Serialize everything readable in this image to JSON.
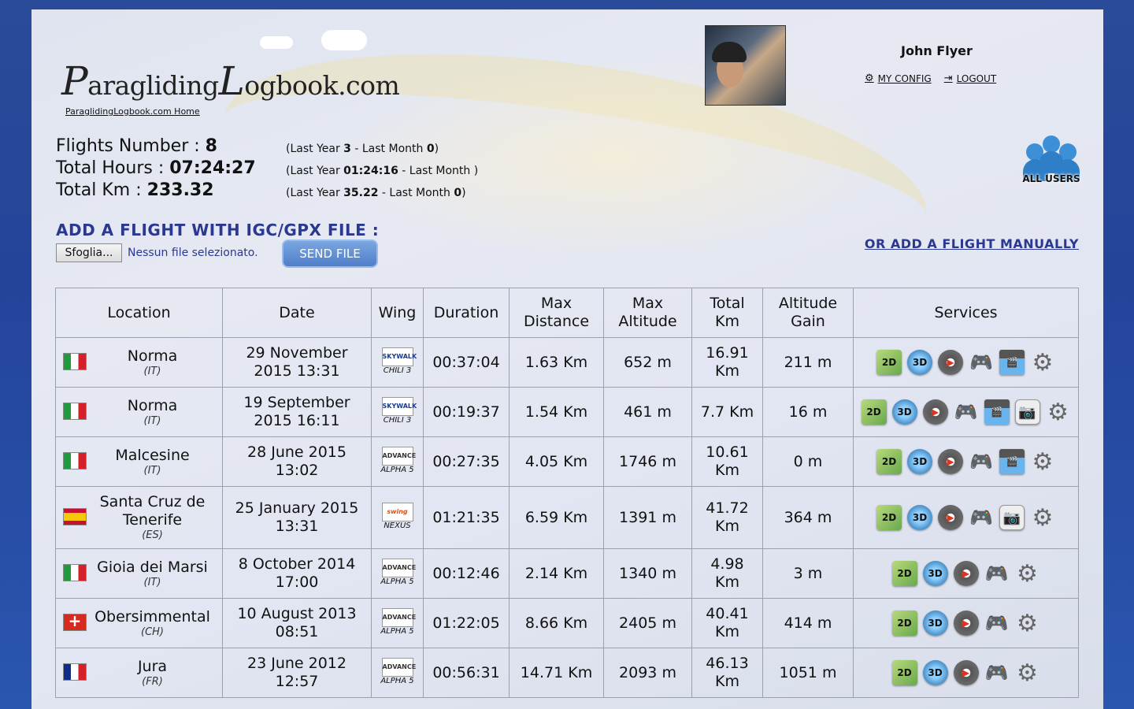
{
  "logo": {
    "text_p": "P",
    "text_rest1": "aragliding",
    "text_l": "L",
    "text_rest2": "ogbook.com",
    "home_link": "ParaglidingLogbook.com Home"
  },
  "user": {
    "name": "John Flyer",
    "config_label": "MY CONFIG",
    "logout_label": "LOGOUT"
  },
  "stats": {
    "flights_label": "Flights Number :",
    "flights_value": "8",
    "hours_label": "Total Hours :",
    "hours_value": "07:24:27",
    "km_label": "Total Km :",
    "km_value": "233.32",
    "flights_sub_a": "(Last Year ",
    "flights_sub_ly": "3",
    "flights_sub_b": " - Last Month ",
    "flights_sub_lm": "0",
    "flights_sub_c": ")",
    "hours_sub_a": "(Last Year ",
    "hours_sub_ly": "01:24:16",
    "hours_sub_b": " - Last Month )",
    "km_sub_a": "(Last Year ",
    "km_sub_ly": "35.22",
    "km_sub_b": " - Last Month ",
    "km_sub_lm": "0",
    "km_sub_c": ")"
  },
  "all_users_label": "ALL USERS",
  "upload": {
    "title": "ADD A FLIGHT WITH IGC/GPX FILE :",
    "browse_label": "Sfoglia...",
    "no_file": "Nessun file selezionato.",
    "send_label": "SEND FILE",
    "manual_link": "OR ADD A FLIGHT MANUALLY"
  },
  "table": {
    "headers": [
      "Location",
      "Date",
      "Wing",
      "Duration",
      "Max Distance",
      "Max Altitude",
      "Total Km",
      "Altitude Gain",
      "Services"
    ],
    "rows": [
      {
        "flag": "it",
        "location": "Norma",
        "cc": "(IT)",
        "date1": "29 November",
        "date2": "2015 13:31",
        "wing_brand": "SKYWALK",
        "wing_model": "CHILI 3",
        "duration": "00:37:04",
        "max_dist": "1.63 Km",
        "max_alt": "652 m",
        "total_km1": "16.91",
        "total_km2": "Km",
        "gain": "211 m"
      },
      {
        "flag": "it",
        "location": "Norma",
        "cc": "(IT)",
        "date1": "19 September",
        "date2": "2015 16:11",
        "wing_brand": "SKYWALK",
        "wing_model": "CHILI 3",
        "duration": "00:19:37",
        "max_dist": "1.54 Km",
        "max_alt": "461 m",
        "total_km1": "7.7 Km",
        "total_km2": "",
        "gain": "16 m"
      },
      {
        "flag": "it",
        "location": "Malcesine",
        "cc": "(IT)",
        "date1": "28 June 2015",
        "date2": "13:02",
        "wing_brand": "ADVANCE",
        "wing_model": "ALPHA 5",
        "duration": "00:27:35",
        "max_dist": "4.05 Km",
        "max_alt": "1746 m",
        "total_km1": "10.61",
        "total_km2": "Km",
        "gain": "0 m"
      },
      {
        "flag": "es",
        "location": "Santa Cruz de Tenerife",
        "cc": "(ES)",
        "date1": "25 January 2015",
        "date2": "13:31",
        "wing_brand": "swing",
        "wing_model": "NEXUS",
        "duration": "01:21:35",
        "max_dist": "6.59 Km",
        "max_alt": "1391 m",
        "total_km1": "41.72",
        "total_km2": "Km",
        "gain": "364 m"
      },
      {
        "flag": "it",
        "location": "Gioia dei Marsi",
        "cc": "(IT)",
        "date1": "8 October 2014",
        "date2": "17:00",
        "wing_brand": "ADVANCE",
        "wing_model": "ALPHA 5",
        "duration": "00:12:46",
        "max_dist": "2.14 Km",
        "max_alt": "1340 m",
        "total_km1": "4.98",
        "total_km2": "Km",
        "gain": "3 m"
      },
      {
        "flag": "ch",
        "location": "Obersimmental",
        "cc": "(CH)",
        "date1": "10 August 2013",
        "date2": "08:51",
        "wing_brand": "ADVANCE",
        "wing_model": "ALPHA 5",
        "duration": "01:22:05",
        "max_dist": "8.66 Km",
        "max_alt": "2405 m",
        "total_km1": "40.41",
        "total_km2": "Km",
        "gain": "414 m"
      },
      {
        "flag": "fr",
        "location": "Jura",
        "cc": "(FR)",
        "date1": "23 June 2012",
        "date2": "12:57",
        "wing_brand": "ADVANCE",
        "wing_model": "ALPHA 5",
        "duration": "00:56:31",
        "max_dist": "14.71 Km",
        "max_alt": "2093 m",
        "total_km1": "46.13",
        "total_km2": "Km",
        "gain": "1051 m"
      }
    ],
    "services": [
      [
        "2d",
        "3d",
        "play",
        "game",
        "film",
        "gear"
      ],
      [
        "2d",
        "3d",
        "play",
        "game",
        "film",
        "cam",
        "gear"
      ],
      [
        "2d",
        "3d",
        "play",
        "game",
        "film",
        "gear"
      ],
      [
        "2d",
        "3d",
        "play",
        "game",
        "cam",
        "gear"
      ],
      [
        "2d",
        "3d",
        "play",
        "game",
        "gear"
      ],
      [
        "2d",
        "3d",
        "play",
        "game",
        "gear"
      ],
      [
        "2d",
        "3d",
        "play",
        "game",
        "gear"
      ]
    ],
    "service_labels": {
      "2d": "2D",
      "3d": "3D",
      "play": "▶",
      "game": "🎮",
      "film": "🎬",
      "cam": "📷",
      "gear": "⚙"
    }
  }
}
